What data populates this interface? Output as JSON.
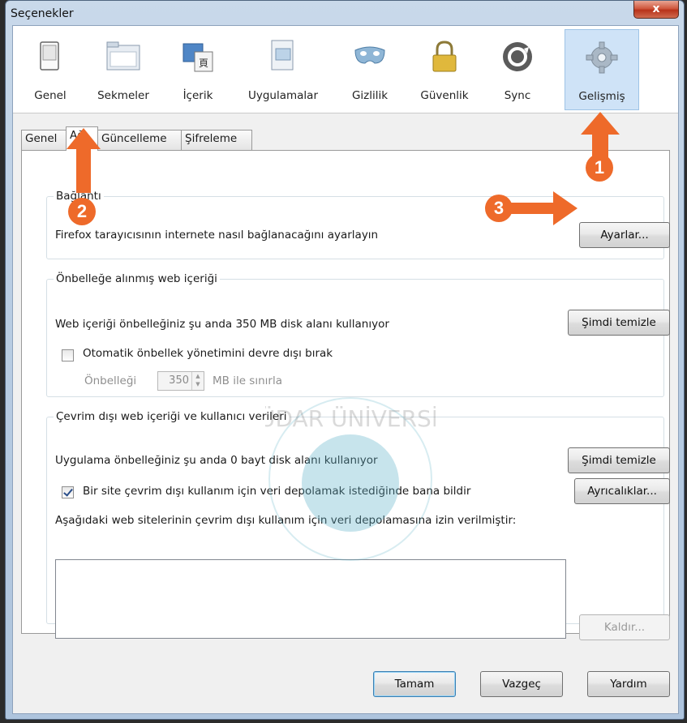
{
  "window": {
    "title": "Seçenekler",
    "close_label": "x"
  },
  "toolbar": {
    "panes": [
      {
        "label": "Genel",
        "icon": "switch-icon"
      },
      {
        "label": "Sekmeler",
        "icon": "tabs-folder-icon"
      },
      {
        "label": "İçerik",
        "icon": "content-image-icon"
      },
      {
        "label": "Uygulamalar",
        "icon": "applications-icon"
      },
      {
        "label": "Gizlilik",
        "icon": "privacy-mask-icon"
      },
      {
        "label": "Güvenlik",
        "icon": "padlock-icon"
      },
      {
        "label": "Sync",
        "icon": "sync-icon"
      },
      {
        "label": "Gelişmiş",
        "icon": "gear-icon"
      }
    ],
    "selected": "Gelişmiş"
  },
  "tabs": [
    {
      "label": "Genel"
    },
    {
      "label": "Ağ"
    },
    {
      "label": "Güncelleme"
    },
    {
      "label": "Şifreleme"
    }
  ],
  "active_tab": "Ağ",
  "connection": {
    "legend": "Bağlantı",
    "description": "Firefox tarayıcısının internete nasıl bağlanacağını ayarlayın",
    "settings_button": "Ayarlar..."
  },
  "cache": {
    "legend": "Önbelleğe alınmış web içeriği",
    "usage_text": "Web içeriği önbelleğiniz şu anda 350 MB disk alanı kullanıyor",
    "clear_button": "Şimdi temizle",
    "override_label": "Otomatik önbellek yönetimini devre dışı bırak",
    "override_checked": false,
    "limit_label": "Önbelleği",
    "limit_value": "350",
    "limit_unit": "MB ile sınırla"
  },
  "offline": {
    "legend": "Çevrim dışı web içeriği ve kullanıcı verileri",
    "usage_text": "Uygulama önbelleğiniz şu anda 0 bayt disk alanı kullanıyor",
    "clear_button": "Şimdi temizle",
    "notify_label": "Bir site çevrim dışı kullanım için veri depolamak istediğinde bana bildir",
    "notify_checked": true,
    "exceptions_button": "Ayrıcalıklar...",
    "allowed_label": "Aşağıdaki web sitelerinin çevrim dışı kullanım için veri depolamasına izin verilmiştir:",
    "remove_button": "Kaldır..."
  },
  "footer": {
    "ok": "Tamam",
    "cancel": "Vazgeç",
    "help": "Yardım"
  },
  "annotations": {
    "badge1": "1",
    "badge2": "2",
    "badge3": "3",
    "color": "#ee6a2a"
  },
  "watermark": {
    "text": "ÜSKÜDAR ÜNİVERSİTESİ",
    "color": "#5fb3c8"
  }
}
